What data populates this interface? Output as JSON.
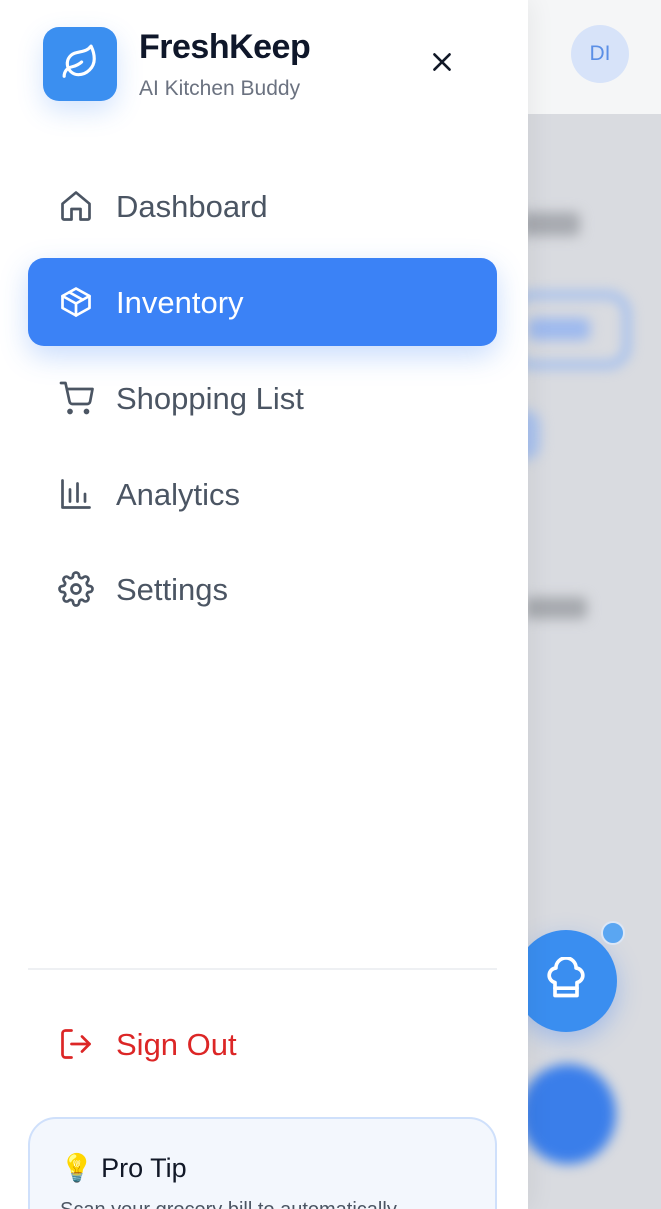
{
  "header": {
    "app_name": "FreshKeep",
    "subtitle": "AI Kitchen Buddy",
    "logo_icon": "leaf-icon",
    "close_icon": "close-icon"
  },
  "user": {
    "initials": "DI"
  },
  "nav": {
    "items": [
      {
        "label": "Dashboard",
        "icon": "home-icon",
        "active": false
      },
      {
        "label": "Inventory",
        "icon": "package-icon",
        "active": true
      },
      {
        "label": "Shopping List",
        "icon": "cart-icon",
        "active": false
      },
      {
        "label": "Analytics",
        "icon": "bar-chart-icon",
        "active": false
      },
      {
        "label": "Settings",
        "icon": "gear-icon",
        "active": false
      }
    ]
  },
  "sign_out": {
    "label": "Sign Out",
    "icon": "logout-icon"
  },
  "pro_tip": {
    "emoji": "💡",
    "title": "Pro Tip",
    "text": "Scan your grocery bill to automatically"
  },
  "fab": {
    "icon": "chef-hat-icon"
  },
  "colors": {
    "accent": "#3b82f6",
    "danger": "#dc2626",
    "text_muted": "#4b5563"
  }
}
